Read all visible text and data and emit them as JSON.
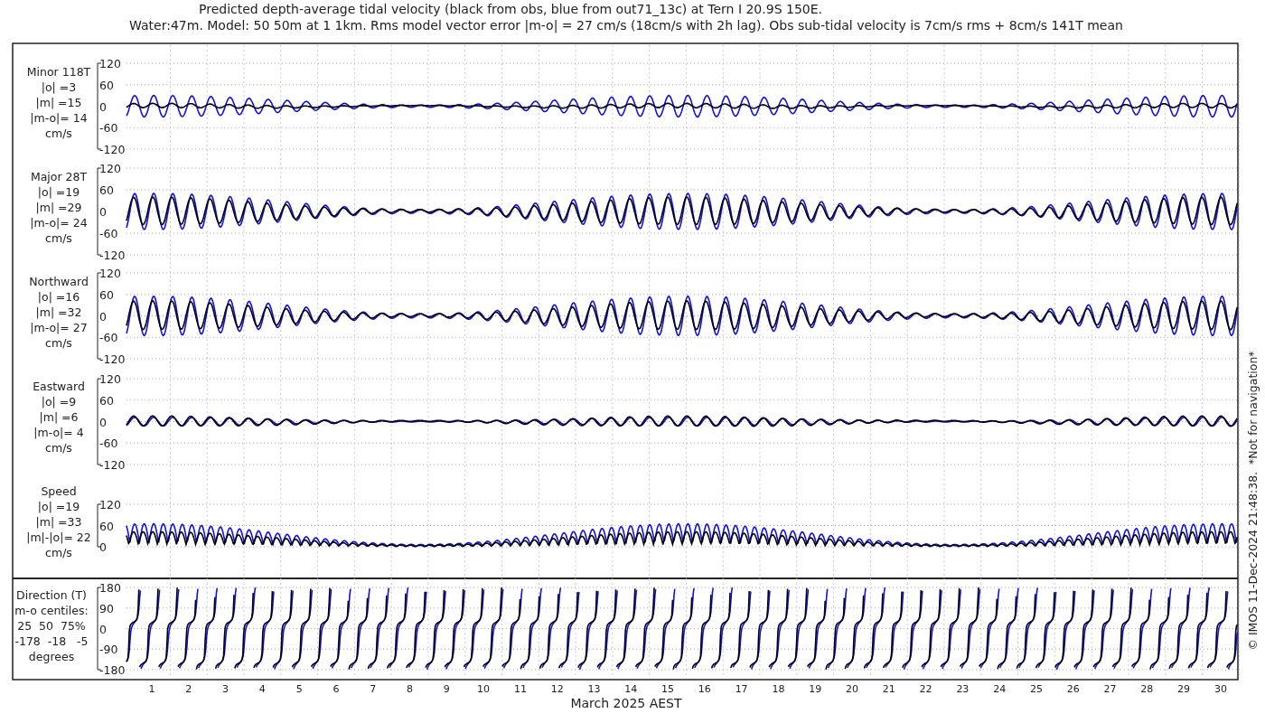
{
  "title_lines": [
    "Predicted depth-average tidal velocity (black from obs, blue from out71_13c) at Tern I 20.9S 150E.",
    "Water:47m. Model: 50 50m at 1 1km. Rms model vector error |m-o| = 27 cm/s (18cm/s with 2h lag). Obs sub-tidal velocity is 7cm/s rms + 8cm/s 141T mean"
  ],
  "panels": [
    {
      "kind": "velocity",
      "label_lines": [
        "Minor 118T",
        "|o| =3",
        "|m| =15",
        "|m-o|= 14",
        "cm/s"
      ],
      "tick_labels": [
        "120",
        "60",
        "0",
        "-60",
        "-120"
      ]
    },
    {
      "kind": "velocity",
      "label_lines": [
        "Major 28T",
        "|o| =19",
        "|m| =29",
        "|m-o|= 24",
        "cm/s"
      ],
      "tick_labels": [
        "120",
        "60",
        "0",
        "-60",
        "-120"
      ]
    },
    {
      "kind": "velocity",
      "label_lines": [
        "Northward",
        "|o| =16",
        "|m| =32",
        "|m-o|= 27",
        "cm/s"
      ],
      "tick_labels": [
        "120",
        "60",
        "0",
        "-60",
        "-120"
      ]
    },
    {
      "kind": "velocity",
      "label_lines": [
        "Eastward",
        "|o| =9",
        "|m| =6",
        "|m-o|= 4",
        "cm/s"
      ],
      "tick_labels": [
        "120",
        "60",
        "0",
        "-60",
        "-120"
      ]
    },
    {
      "kind": "speed",
      "label_lines": [
        "Speed",
        "|o| =19",
        "|m| =33",
        "|m|-|o|= 22",
        "cm/s"
      ],
      "tick_labels": [
        "120",
        "60",
        "0"
      ]
    },
    {
      "kind": "direction",
      "label_lines": [
        "Direction (T)",
        "m-o centiles:",
        "25  50  75%",
        "-178  -18   -5",
        "degrees"
      ],
      "tick_labels": [
        "180",
        "90",
        "0",
        "-90",
        "-180"
      ]
    }
  ],
  "day_labels": [
    "1",
    "2",
    "3",
    "4",
    "5",
    "6",
    "7",
    "8",
    "9",
    "10",
    "11",
    "12",
    "13",
    "14",
    "15",
    "16",
    "17",
    "18",
    "19",
    "20",
    "21",
    "22",
    "23",
    "24",
    "25",
    "26",
    "27",
    "28",
    "29",
    "30"
  ],
  "xlabel": "March 2025 AEST",
  "side_note": "© IMOS 11-Dec-2024 21:48:38.  *Not for navigation*"
}
